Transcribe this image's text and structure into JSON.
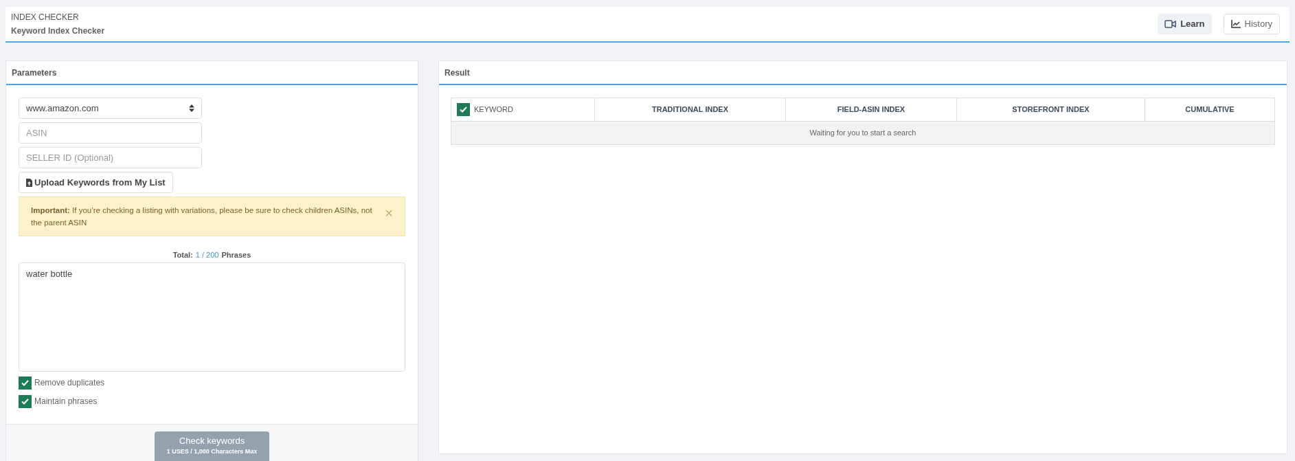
{
  "header": {
    "title": "INDEX CHECKER",
    "subtitle": "Keyword Index Checker",
    "buttons": [
      {
        "kind": "video",
        "label": "Learn",
        "selected": true
      },
      {
        "kind": "chart",
        "label": "History",
        "selected": false
      }
    ]
  },
  "parameters": {
    "title": "Parameters",
    "marketplace": "www.amazon.com",
    "asin": {
      "placeholder": "ASIN"
    },
    "seller_id": {
      "placeholder": "SELLER ID (Optional)"
    },
    "upload_button": "Upload Keywords from My List",
    "alert": {
      "text": "**Important:** If you’re checking a listing with variations, please be sure to check children ASINs, not the parent ASIN",
      "close": "×"
    },
    "total": {
      "label": "Total:",
      "count": "1 / 200",
      "unit": "Phrases"
    },
    "keywords": "water bottle",
    "options": [
      {
        "label": "Remove duplicates",
        "checked": true
      },
      {
        "label": "Maintain phrases",
        "checked": true
      }
    ],
    "submit": {
      "label": "Check keywords",
      "sublabel": "1 USES / 1,000 Characters Max"
    }
  },
  "result": {
    "title": "Result",
    "table": {
      "select_all": true,
      "columns": [
        "KEYWORD",
        "TRADITIONAL INDEX",
        "FIELD-ASIN INDEX",
        "STOREFRONT INDEX",
        "CUMULATIVE"
      ],
      "empty_message": "Waiting for you to start a search"
    }
  }
}
